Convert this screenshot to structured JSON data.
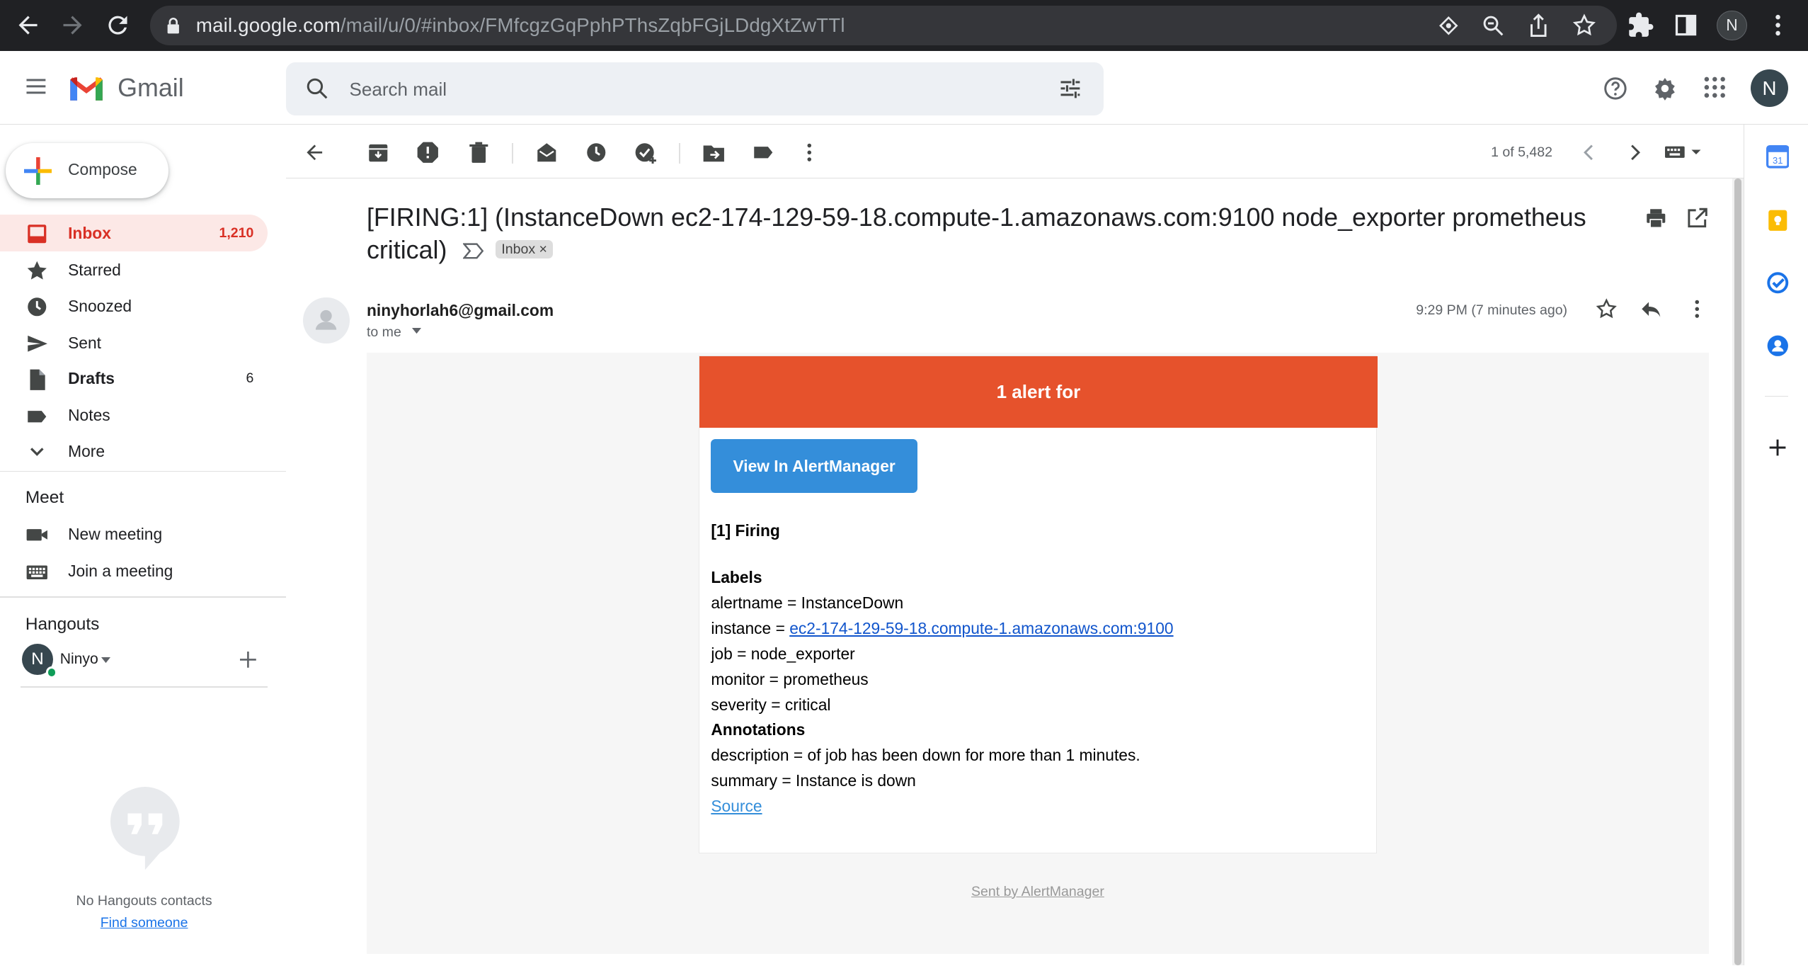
{
  "browser": {
    "url_host": "mail.google.com",
    "url_path": "/mail/u/0/#inbox/FMfcgzGqPphPThsZqbFGjLDdgXtZwTTl",
    "profile_initial": "N"
  },
  "header": {
    "app_name": "Gmail",
    "search_placeholder": "Search mail",
    "account_initial": "N"
  },
  "sidebar": {
    "compose_label": "Compose",
    "items": [
      {
        "label": "Inbox",
        "count": "1,210",
        "icon": "inbox-icon",
        "active": true
      },
      {
        "label": "Starred",
        "count": "",
        "icon": "star-icon"
      },
      {
        "label": "Snoozed",
        "count": "",
        "icon": "clock-icon"
      },
      {
        "label": "Sent",
        "count": "",
        "icon": "send-icon"
      },
      {
        "label": "Drafts",
        "count": "6",
        "icon": "draft-icon"
      },
      {
        "label": "Notes",
        "count": "",
        "icon": "label-icon"
      },
      {
        "label": "More",
        "count": "",
        "icon": "chevron-down-icon"
      }
    ],
    "meet": {
      "title": "Meet",
      "new_meeting": "New meeting",
      "join_meeting": "Join a meeting"
    },
    "hangouts": {
      "title": "Hangouts",
      "user_initial": "N",
      "user_name": "Ninyo",
      "empty_text": "No Hangouts contacts",
      "find_link": "Find someone"
    }
  },
  "toolbar": {
    "pager_text": "1 of 5,482"
  },
  "message": {
    "subject": "[FIRING:1] (InstanceDown ec2-174-129-59-18.compute-1.amazonaws.com:9100 node_exporter prometheus critical)",
    "label_chip": "Inbox",
    "sender": "ninyhorlah6@gmail.com",
    "recipient": "to me",
    "time": "9:29 PM (7 minutes ago)"
  },
  "email": {
    "banner": "1 alert for",
    "button": "View In AlertManager",
    "firing": "[1] Firing",
    "labels_heading": "Labels",
    "alertname": "alertname = InstanceDown",
    "instance_prefix": "instance = ",
    "instance_link": "ec2-174-129-59-18.compute-1.amazonaws.com:9100",
    "job": "job = node_exporter",
    "monitor": "monitor = prometheus",
    "severity": "severity = critical",
    "annotations_heading": "Annotations",
    "description": "description = of job has been down for more than 1 minutes.",
    "summary": "summary = Instance is down",
    "source_link": "Source",
    "footer": "Sent by AlertManager"
  },
  "colors": {
    "alert_banner": "#e6522c",
    "alertmanager_button": "#348eda",
    "inbox_active": "#d93025"
  }
}
